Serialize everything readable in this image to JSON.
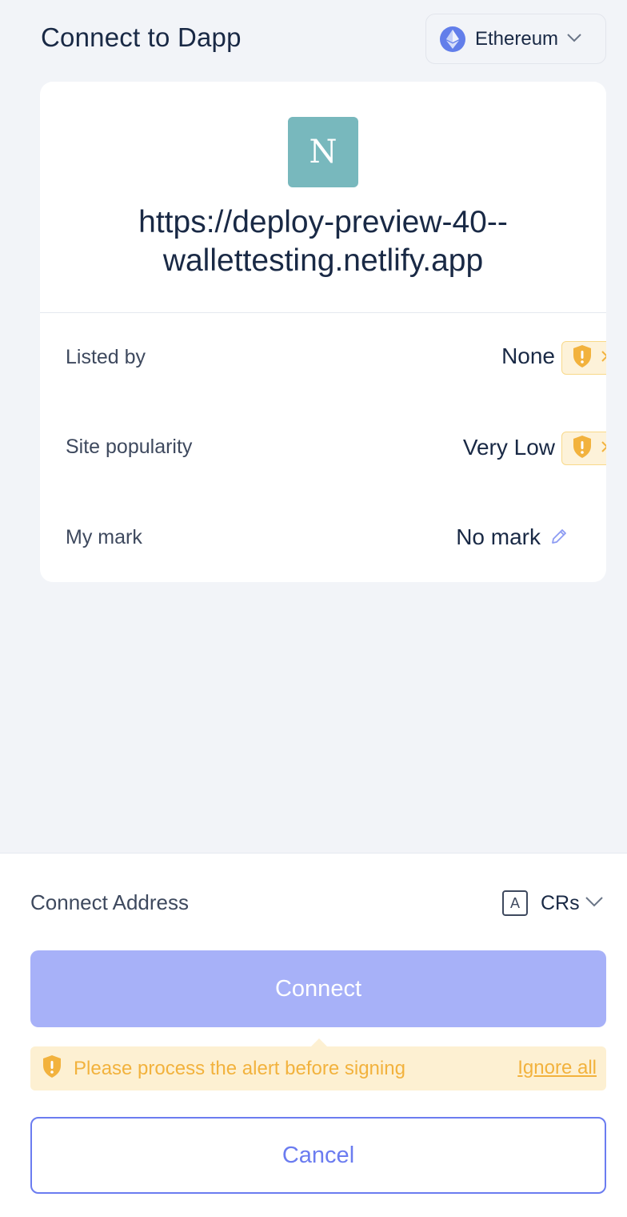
{
  "header": {
    "title": "Connect to Dapp",
    "chain": {
      "label": "Ethereum",
      "icon": "ethereum-icon"
    }
  },
  "site": {
    "logo_letter": "N",
    "logo_color": "#78b8bd",
    "origin": "https://deploy-preview-40--wallettesting.netlify.app",
    "rows": [
      {
        "label": "Listed by",
        "value": "None",
        "alert": true
      },
      {
        "label": "Site popularity",
        "value": "Very Low",
        "alert": true
      },
      {
        "label": "My mark",
        "value": "No mark",
        "editable": true
      }
    ]
  },
  "connect": {
    "address_label": "Connect Address",
    "account_icon_letter": "A",
    "account_name": "CRs",
    "connect_label": "Connect",
    "warning_text": "Please process the alert before signing",
    "ignore_label": "Ignore all",
    "cancel_label": "Cancel"
  },
  "colors": {
    "primary": "#6b7cf0",
    "primary_disabled": "#a7b1f8",
    "warning": "#f2b23d",
    "warning_bg": "#fdf0d2"
  }
}
